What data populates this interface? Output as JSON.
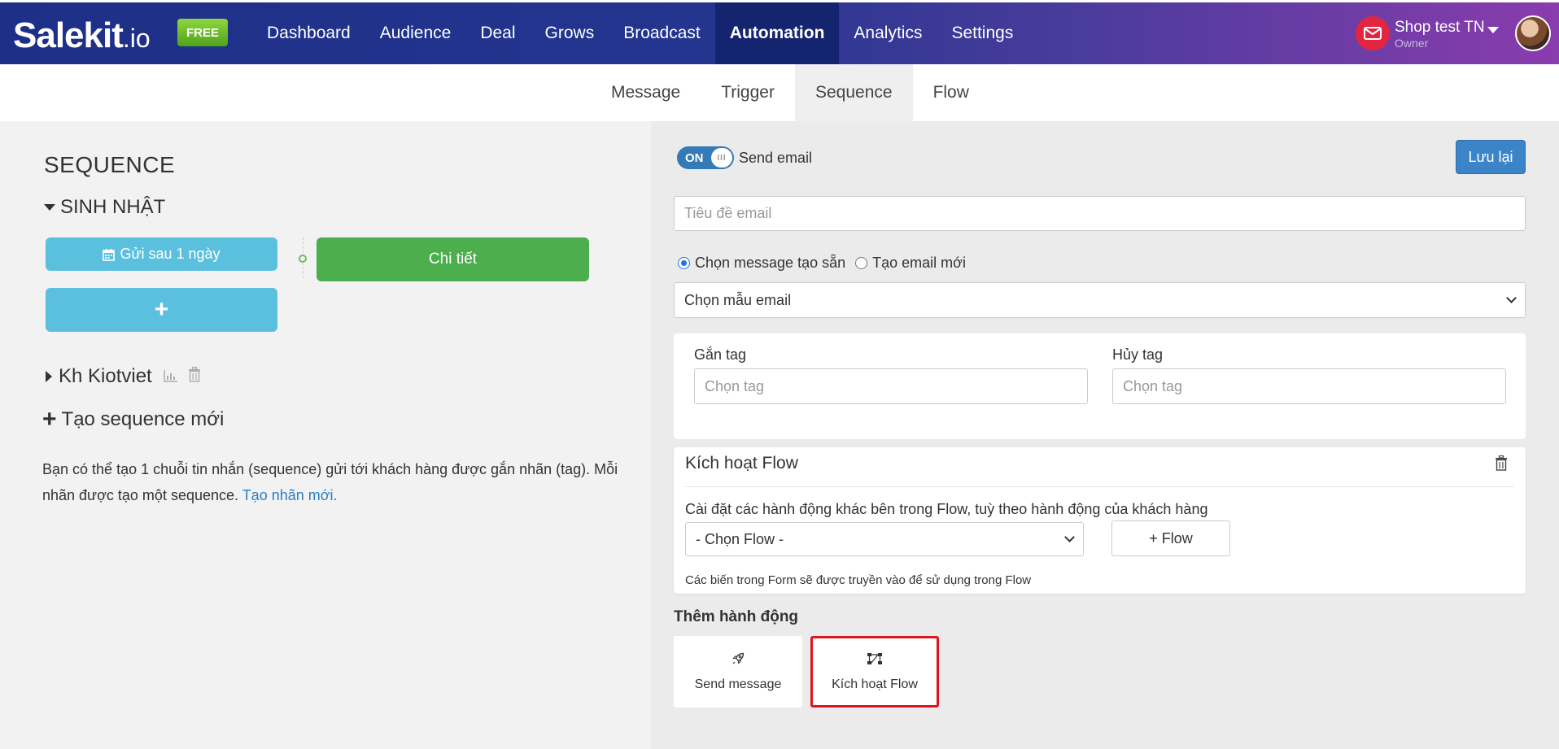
{
  "nav": {
    "logo_brand": "Salekit",
    "logo_tld": ".io",
    "badge": "FREE",
    "items": [
      {
        "label": "Dashboard"
      },
      {
        "label": "Audience"
      },
      {
        "label": "Deal"
      },
      {
        "label": "Grows"
      },
      {
        "label": "Broadcast"
      },
      {
        "label": "Automation",
        "active": true
      },
      {
        "label": "Analytics"
      },
      {
        "label": "Settings"
      }
    ],
    "user": {
      "shop": "Shop test TN",
      "role": "Owner"
    }
  },
  "subnav": {
    "items": [
      {
        "label": "Message"
      },
      {
        "label": "Trigger"
      },
      {
        "label": "Sequence",
        "active": true
      },
      {
        "label": "Flow"
      }
    ]
  },
  "left": {
    "title": "SEQUENCE",
    "group_open": "SINH NHẬT",
    "send_after": "Gửi sau 1 ngày",
    "add_button": "+",
    "detail_button": "Chi tiết",
    "group_closed": "Kh Kiotviet",
    "new_sequence": "Tạo sequence mới",
    "desc_text": "Bạn có thể tạo 1 chuỗi tin nhắn (sequence) gửi tới khách hàng được gắn nhãn (tag). Mỗi nhãn được tạo một sequence. ",
    "desc_link": "Tạo nhãn mới."
  },
  "right": {
    "toggle_state": "ON",
    "toggle_label": "Send email",
    "save_button": "Lưu lại",
    "email_title_placeholder": "Tiêu đề email",
    "radio_preset": "Chọn message tạo sẵn",
    "radio_new": "Tạo email mới",
    "email_template_select": "Chọn mẫu email",
    "tag_add_label": "Gắn tag",
    "tag_remove_label": "Hủy tag",
    "tag_placeholder": "Chọn tag",
    "flow_title": "Kích hoạt Flow",
    "flow_desc": "Cài đặt các hành động khác bên trong Flow, tuỳ theo hành động của khách hàng",
    "flow_select": "- Chọn Flow -",
    "flow_add_button": "+ Flow",
    "flow_note": "Các biến trong Form sẽ được truyền vào để sử dụng trong Flow",
    "add_action_title": "Thêm hành động",
    "action_send": "Send message",
    "action_flow": "Kích hoạt Flow"
  },
  "colors": {
    "nav_start": "#1d2f86",
    "nav_end": "#8a3cad",
    "nav_active": "#14246f",
    "btn_info": "#5bc0de",
    "btn_success": "#4cae4c",
    "btn_primary": "#3c84c8",
    "highlight": "#e0141e"
  }
}
